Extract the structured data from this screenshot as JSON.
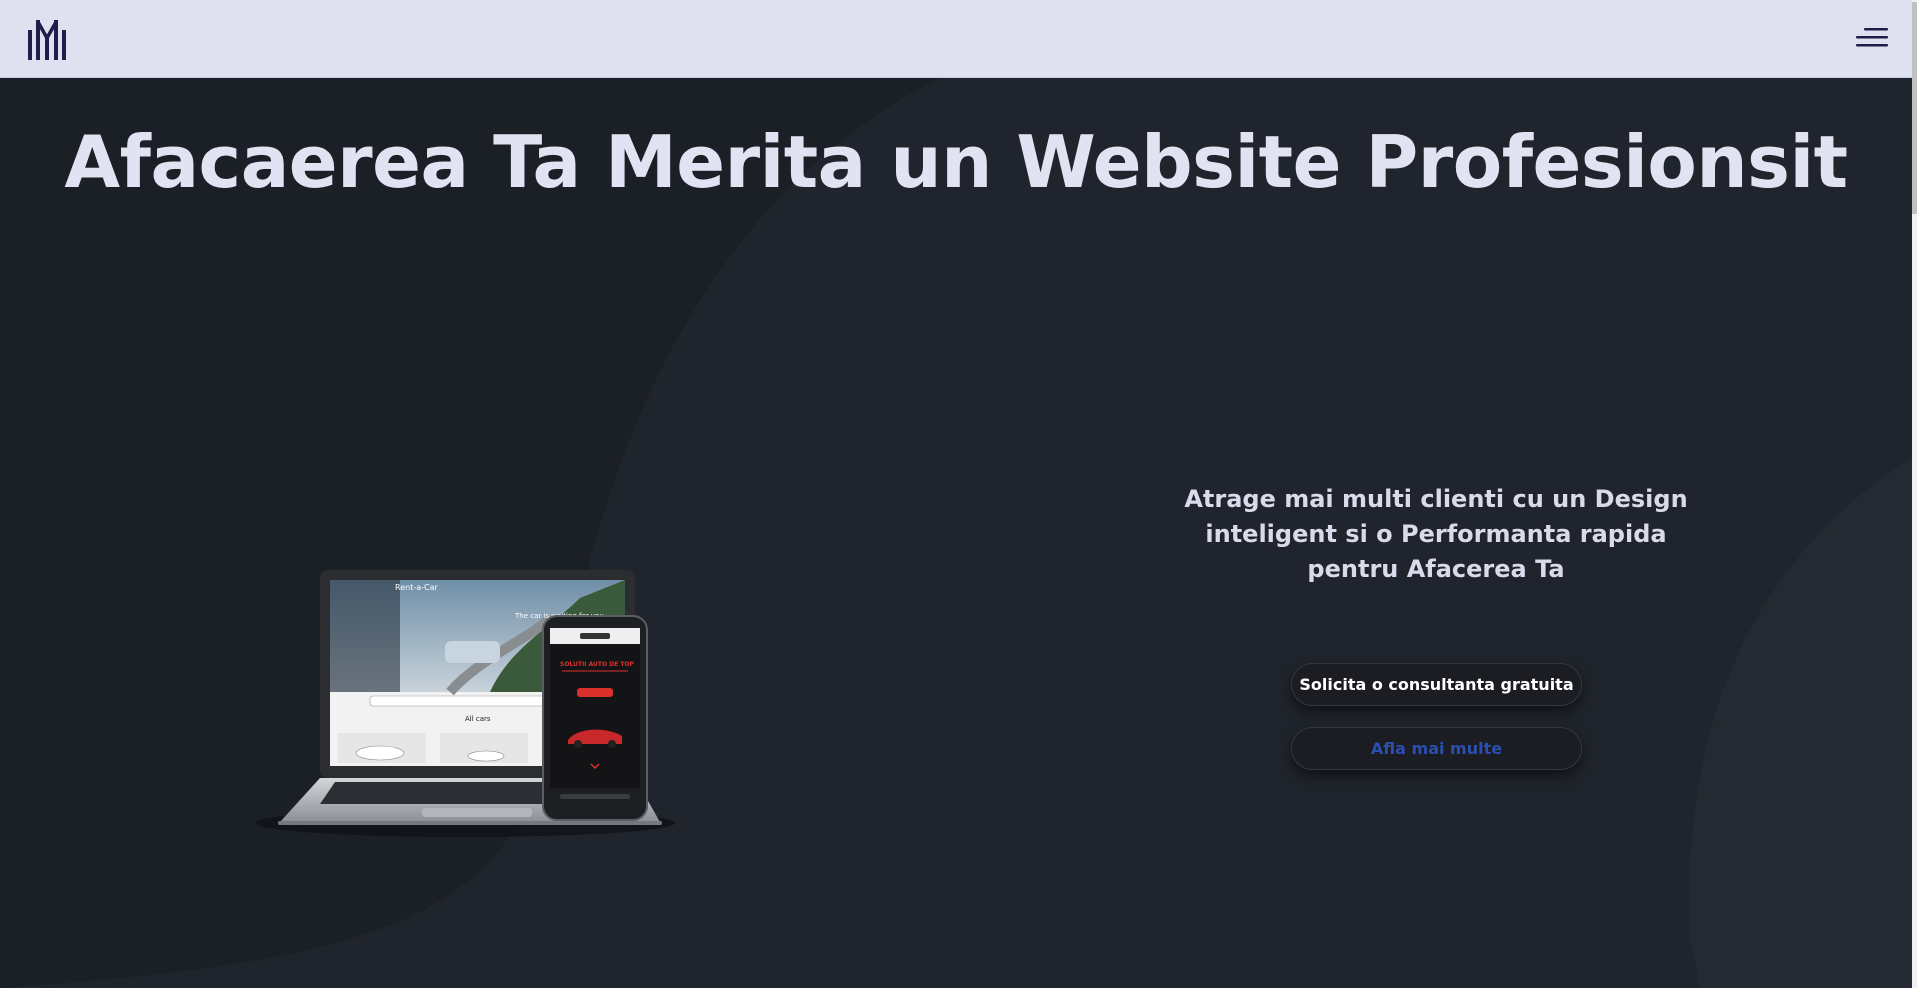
{
  "header": {
    "logo_icon": "monogram-logo-icon",
    "menu_icon": "hamburger-menu-icon"
  },
  "hero": {
    "title": "Afacaerea Ta Merita un Website Profesionsit",
    "tagline": "Atrage mai multi clienti cu un Design inteligent si o Performanta rapida pentru Afacerea Ta",
    "primary_button": "Solicita o consultanta gratuita",
    "secondary_button": "Afla mai multe"
  },
  "devices_image": {
    "laptop_screen": {
      "brand": "Rent-a-Car",
      "headline": "The car is waiting for you",
      "section": "All cars"
    },
    "phone_screen": {
      "headline": "SOLUTII AUTO DE TOP"
    }
  },
  "colors": {
    "header_bg": "#dfe1f0",
    "page_bg": "#1c2027",
    "title_color": "#e1e3f2",
    "secondary_button_text": "#2a4fb0",
    "logo_color": "#1f1d4a",
    "phone_accent": "#d9302c"
  }
}
